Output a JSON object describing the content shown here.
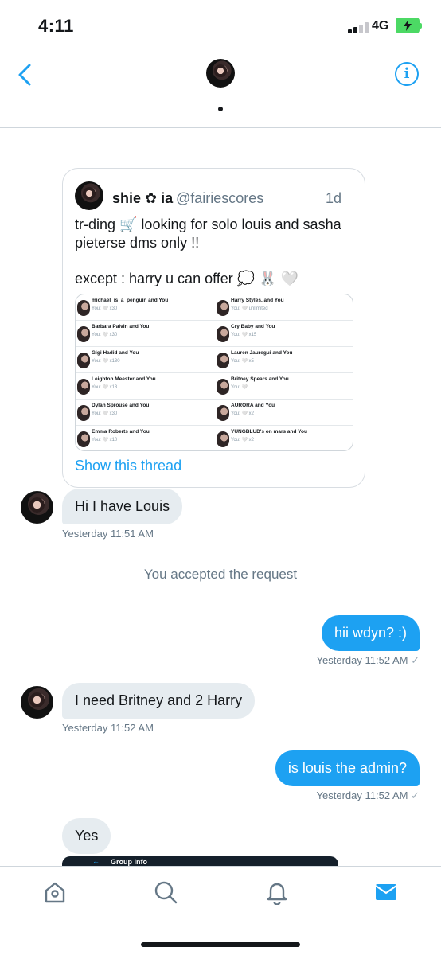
{
  "status_bar": {
    "time": "4:11",
    "network": "4G"
  },
  "tweet": {
    "name": "shie ✿ ia",
    "handle": "@fairiescores",
    "age": "1d",
    "text_line1": "tr-ding 🛒 looking for solo louis and sasha pieterse dms only !!",
    "text_line2": "except : harry u can offer 💭 🐰 🤍",
    "show_thread": "Show this thread",
    "thumbnail": {
      "left": [
        {
          "name": "michael_is_a_penguin and You",
          "sub": "You: 🤍 x30"
        },
        {
          "name": "Barbara Palvin and You",
          "sub": "You: 🤍 x30"
        },
        {
          "name": "Gigi Hadid and You",
          "sub": "You: 🤍 x130"
        },
        {
          "name": "Leighton Meester and You",
          "sub": "You: 🤍 x13"
        },
        {
          "name": "Dylan Sprouse and You",
          "sub": "You: 🤍 x30"
        },
        {
          "name": "Emma Roberts and You",
          "sub": "You: 🤍 x10"
        }
      ],
      "right": [
        {
          "name": "Harry Styles. and You",
          "sub": "You: 🤍 unlimited"
        },
        {
          "name": "Cry Baby and You",
          "sub": "You: 🤍 x15"
        },
        {
          "name": "Lauren Jauregui and You",
          "sub": "You: 🤍 x5"
        },
        {
          "name": "Britney Spears and You",
          "sub": "You: 🤍"
        },
        {
          "name": "AURORA and You",
          "sub": "You: 🤍 x2"
        },
        {
          "name": "YUNGBLUD's on mars and You",
          "sub": "You: 🤍 x2"
        }
      ]
    }
  },
  "messages": [
    {
      "direction": "in",
      "text": "Hi I have Louis",
      "meta": "Yesterday 11:51 AM"
    },
    {
      "direction": "system",
      "text": "You accepted the request"
    },
    {
      "direction": "out",
      "text": "hii wdyn? :)",
      "meta": "Yesterday 11:52 AM"
    },
    {
      "direction": "in",
      "text": "I need Britney and 2 Harry",
      "meta": "Yesterday 11:52 AM"
    },
    {
      "direction": "out",
      "text": "is louis the admin?",
      "meta": "Yesterday 11:52 AM"
    },
    {
      "direction": "in",
      "text": "Yes"
    }
  ],
  "shared_image": {
    "title": "Group info"
  },
  "colors": {
    "accent": "#1da1f2",
    "incoming_bubble": "#e6ecf0",
    "meta": "#657786"
  },
  "icons": {
    "back": "chevron-left-icon",
    "info": "info-icon",
    "home": "home-icon",
    "search": "search-icon",
    "notifications": "bell-icon",
    "messages": "mail-icon"
  }
}
